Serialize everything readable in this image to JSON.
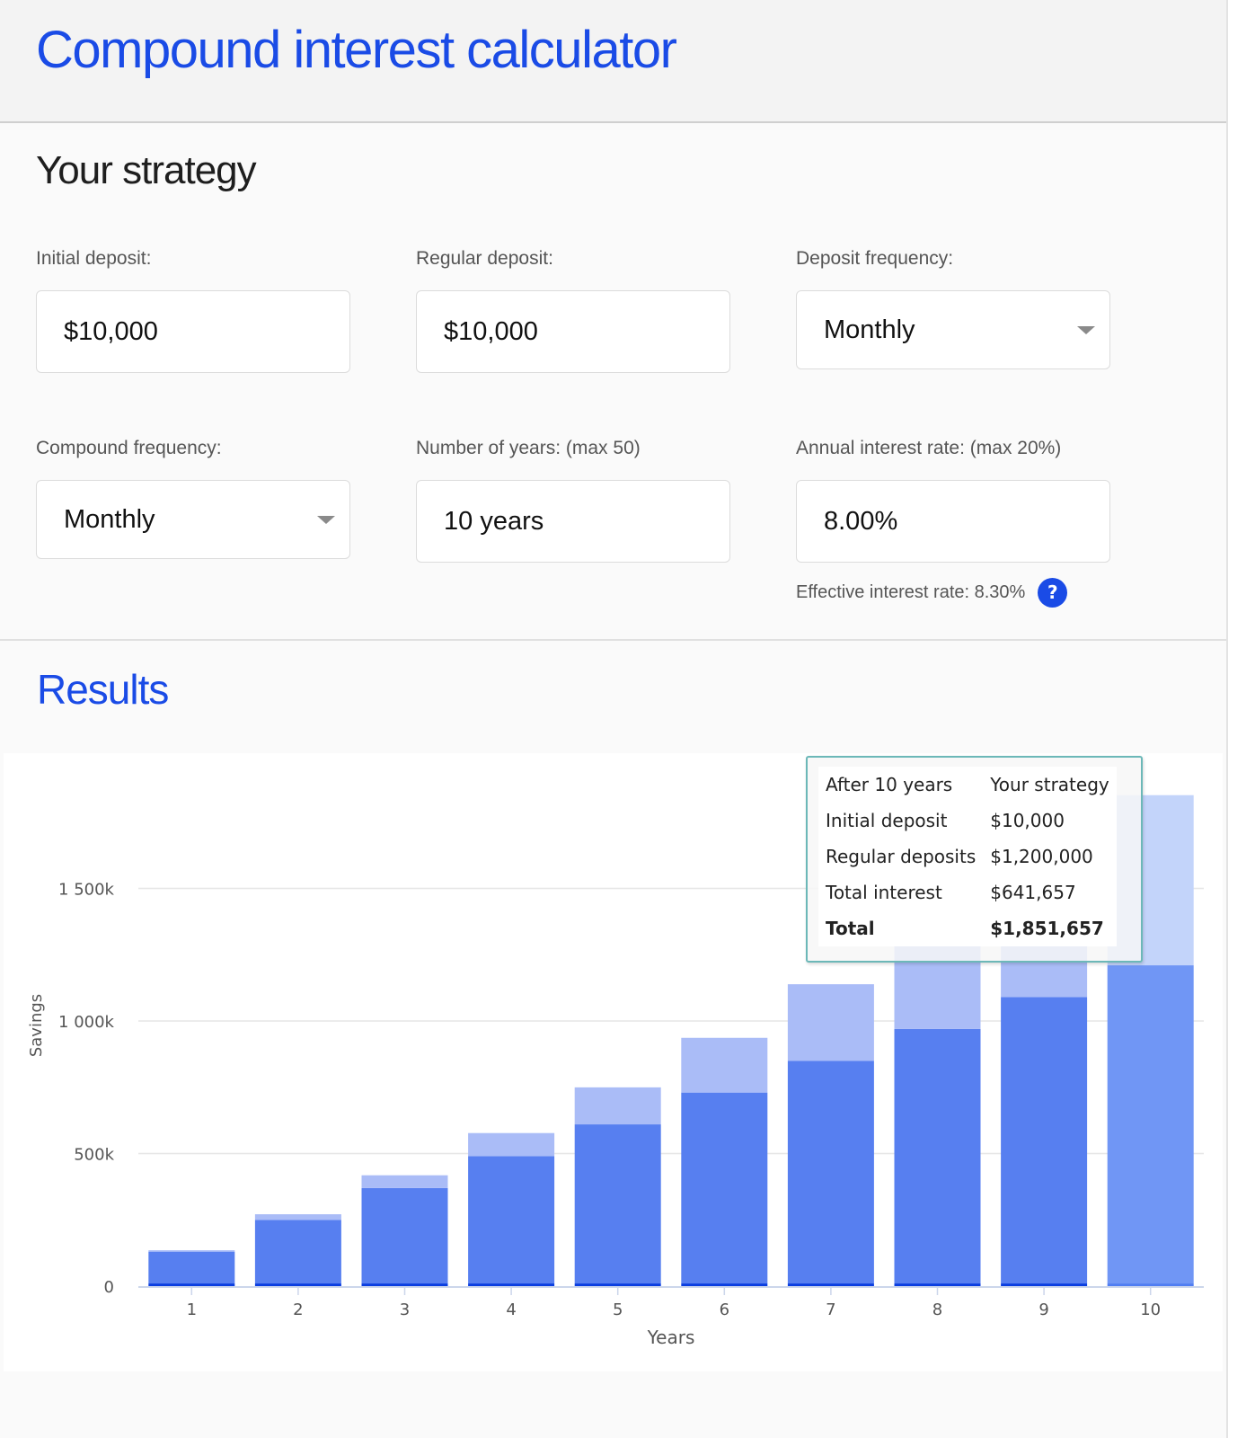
{
  "header": {
    "title": "Compound interest calculator"
  },
  "strategy": {
    "title": "Your strategy",
    "fields": {
      "initial_deposit": {
        "label": "Initial deposit:",
        "value": "$10,000"
      },
      "regular_deposit": {
        "label": "Regular deposit:",
        "value": "$10,000"
      },
      "deposit_frequency": {
        "label": "Deposit frequency:",
        "value": "Monthly"
      },
      "compound_frequency": {
        "label": "Compound frequency:",
        "value": "Monthly"
      },
      "years": {
        "label": "Number of years: (max 50)",
        "value": "10 years"
      },
      "interest_rate": {
        "label": "Annual interest rate: (max 20%)",
        "value": "8.00%"
      }
    },
    "effective_rate": "Effective interest rate: 8.30%",
    "help_icon": "?"
  },
  "results": {
    "title": "Results"
  },
  "tooltip": {
    "rows": [
      {
        "label": "After 10 years",
        "value": "Your strategy",
        "bold": false
      },
      {
        "label": "Initial deposit",
        "value": "$10,000",
        "bold": false
      },
      {
        "label": "Regular deposits",
        "value": "$1,200,000",
        "bold": false
      },
      {
        "label": "Total interest",
        "value": "$641,657",
        "bold": false
      },
      {
        "label": "Total",
        "value": "$1,851,657",
        "bold": true
      }
    ]
  },
  "colors": {
    "accent": "#1a4be6",
    "initial": "#0a3ee0",
    "deposits": "#577ff0",
    "interest": "#aabcf7",
    "deposits_hover": "#7096f5",
    "interest_hover": "#c3d4fa",
    "grid": "#e6e6e6"
  },
  "chart_data": {
    "type": "bar",
    "stacked": true,
    "title": "",
    "xlabel": "Years",
    "ylabel": "Savings",
    "categories": [
      "1",
      "2",
      "3",
      "4",
      "5",
      "6",
      "7",
      "8",
      "9",
      "10"
    ],
    "ylim": [
      0,
      1900000
    ],
    "yticks": [
      0,
      500000,
      1000000,
      1500000
    ],
    "ytick_labels": [
      "0",
      "500k",
      "1 000k",
      "1 500k"
    ],
    "grid": true,
    "hovered_index": 9,
    "series": [
      {
        "name": "Initial deposit",
        "values": [
          10000,
          10000,
          10000,
          10000,
          10000,
          10000,
          10000,
          10000,
          10000,
          10000
        ]
      },
      {
        "name": "Regular deposits",
        "values": [
          120000,
          240000,
          360000,
          480000,
          600000,
          720000,
          840000,
          960000,
          1080000,
          1200000
        ]
      },
      {
        "name": "Total interest",
        "values": [
          5330,
          21061,
          48058,
          87256,
          139667,
          206388,
          288607,
          387611,
          504790,
          641657
        ]
      }
    ]
  }
}
